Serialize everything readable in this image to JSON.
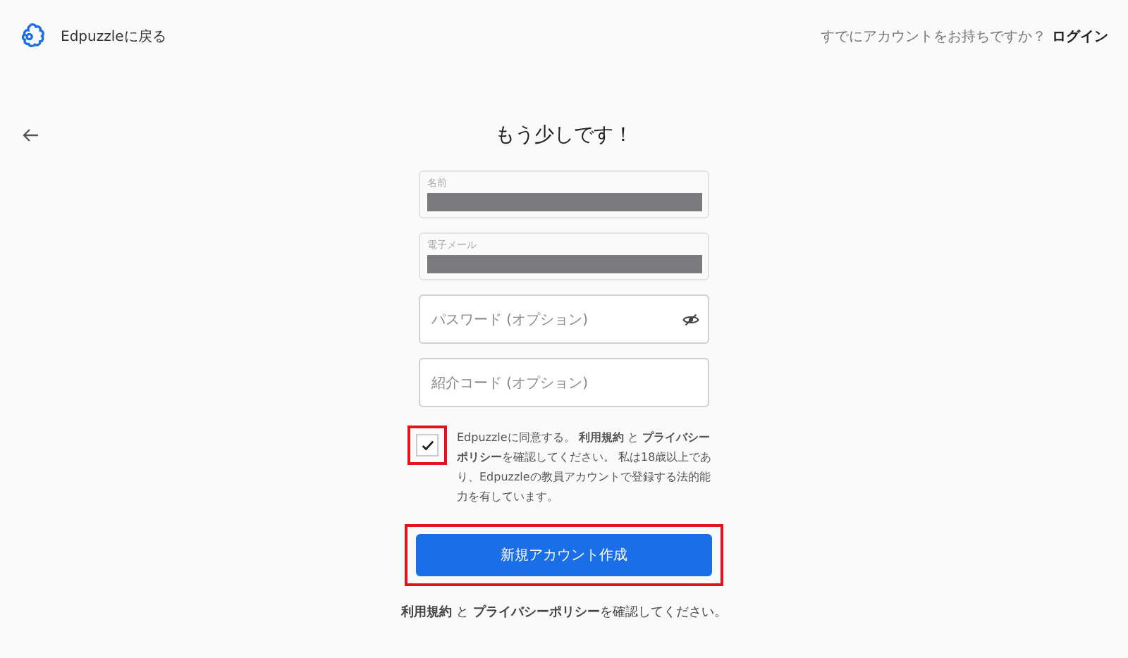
{
  "header": {
    "back_link": "Edpuzzleに戻る",
    "login_prompt": "すでにアカウントをお持ちですか？",
    "login_link": "ログイン"
  },
  "title": "もう少しです！",
  "fields": [
    {
      "kind": "filled",
      "label": "名前",
      "redacted": true
    },
    {
      "kind": "filled",
      "label": "電子メール",
      "redacted": true
    },
    {
      "kind": "password",
      "placeholder": "パスワード (オプション)"
    },
    {
      "kind": "empty",
      "placeholder": "紹介コード (オプション)"
    }
  ],
  "agreement": {
    "checked": true,
    "highlighted": true,
    "text": "Edpuzzleに同意する。 **利用規約** と **プライバシーポリシー**を確認してください。 私は18歳以上であり、Edpuzzleの教員アカウントで登録する法的能力を有しています。"
  },
  "submit": {
    "label": "新規アカウント作成",
    "highlighted": true
  },
  "footer_note": "**利用規約** と **プライバシーポリシー**を確認してください。"
}
